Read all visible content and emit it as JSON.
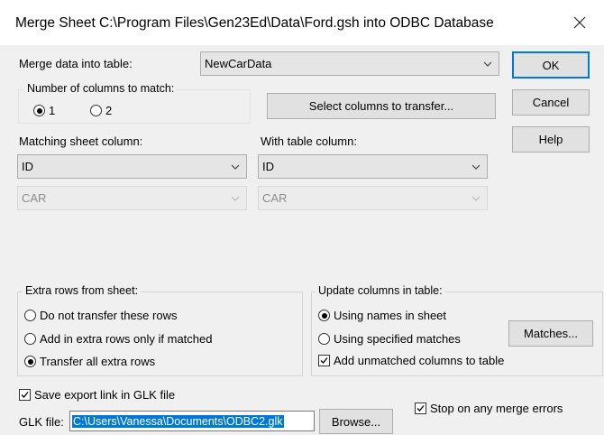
{
  "dialog": {
    "title": "Merge Sheet C:\\Program Files\\Gen23Ed\\Data\\Ford.gsh into ODBC Database",
    "close_glyph": "✕"
  },
  "merge_table": {
    "label": "Merge data into table:",
    "value": "NewCarData"
  },
  "buttons": {
    "ok": "OK",
    "cancel": "Cancel",
    "help": "Help",
    "select_columns": "Select columns to transfer...",
    "matches": "Matches...",
    "browse": "Browse..."
  },
  "columns_to_match": {
    "title": "Number of columns to match:",
    "options": [
      {
        "label": "1",
        "selected": true
      },
      {
        "label": "2",
        "selected": false
      }
    ]
  },
  "matching": {
    "sheet_label": "Matching sheet column:",
    "table_label": "With table column:",
    "rows": [
      {
        "sheet": "ID",
        "table": "ID",
        "enabled": true
      },
      {
        "sheet": "CAR",
        "table": "CAR",
        "enabled": false
      }
    ]
  },
  "extra_rows": {
    "title": "Extra rows from sheet:",
    "options": [
      {
        "label": "Do not transfer these rows",
        "selected": false
      },
      {
        "label": "Add in extra rows only if matched",
        "selected": false
      },
      {
        "label": "Transfer all extra rows",
        "selected": true
      }
    ]
  },
  "update_columns": {
    "title": "Update columns in table:",
    "options": [
      {
        "label": "Using names in sheet",
        "selected": true
      },
      {
        "label": "Using specified matches",
        "selected": false
      }
    ],
    "add_unmatched": {
      "label": "Add unmatched columns to table",
      "checked": true
    }
  },
  "save_link": {
    "label": "Save export link in GLK file",
    "checked": true
  },
  "stop_on_errors": {
    "label": "Stop on any merge errors",
    "checked": true
  },
  "glk": {
    "label": "GLK file:",
    "value": "C:\\Users\\Vanessa\\Documents\\ODBC2.glk"
  },
  "colors": {
    "accent": "#0078d7",
    "dialog_bg": "#f0f0f0"
  }
}
